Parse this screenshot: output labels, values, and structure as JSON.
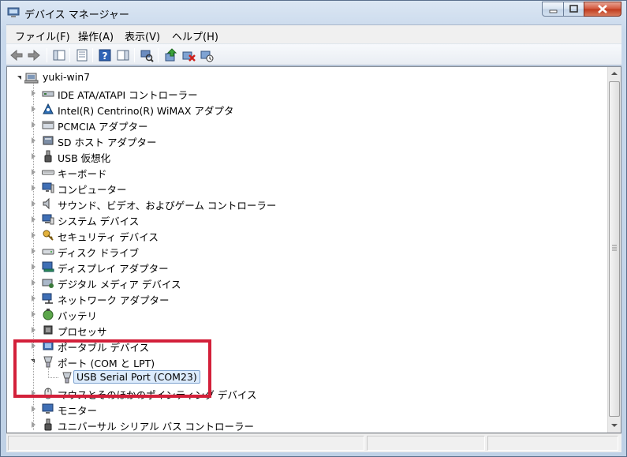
{
  "window": {
    "title": "デバイス マネージャー"
  },
  "menu": [
    {
      "label": "ファイル(F)"
    },
    {
      "label": "操作(A)"
    },
    {
      "label": "表示(V)"
    },
    {
      "label": "ヘルプ(H)"
    }
  ],
  "toolbar": [
    "back-arrow-icon",
    "forward-arrow-icon",
    "show-hide-console-tree-icon",
    "properties-icon",
    "help-icon",
    "action-pane-icon",
    "scan-hardware-icon",
    "update-driver-icon",
    "uninstall-icon",
    "disable-device-icon"
  ],
  "tree": {
    "root": "yuki-win7",
    "items": [
      {
        "label": "IDE ATA/ATAPI コントローラー",
        "icon": "ide-controller-icon"
      },
      {
        "label": "Intel(R) Centrino(R) WiMAX アダプタ",
        "icon": "wimax-icon"
      },
      {
        "label": "PCMCIA アダプター",
        "icon": "pcmcia-icon"
      },
      {
        "label": "SD ホスト アダプター",
        "icon": "sd-host-icon"
      },
      {
        "label": "USB 仮想化",
        "icon": "usb-icon"
      },
      {
        "label": "キーボード",
        "icon": "keyboard-icon"
      },
      {
        "label": "コンピューター",
        "icon": "computer-icon"
      },
      {
        "label": "サウンド、ビデオ、およびゲーム コントローラー",
        "icon": "speaker-icon"
      },
      {
        "label": "システム デバイス",
        "icon": "system-device-icon"
      },
      {
        "label": "セキュリティ デバイス",
        "icon": "security-key-icon"
      },
      {
        "label": "ディスク ドライブ",
        "icon": "disk-drive-icon"
      },
      {
        "label": "ディスプレイ アダプター",
        "icon": "display-adapter-icon"
      },
      {
        "label": "デジタル メディア デバイス",
        "icon": "media-device-icon"
      },
      {
        "label": "ネットワーク アダプター",
        "icon": "network-adapter-icon"
      },
      {
        "label": "バッテリ",
        "icon": "battery-icon"
      },
      {
        "label": "プロセッサ",
        "icon": "processor-icon"
      },
      {
        "label": "ポータブル デバイス",
        "icon": "portable-device-icon"
      },
      {
        "label": "ポート (COM と LPT)",
        "icon": "port-icon",
        "expanded": true,
        "children": [
          {
            "label": "USB Serial Port (COM23)",
            "icon": "serial-port-icon",
            "selected": true
          }
        ]
      },
      {
        "label": "マウスとそのほかのポインティング デバイス",
        "icon": "mouse-icon"
      },
      {
        "label": "モニター",
        "icon": "monitor-icon"
      },
      {
        "label": "ユニバーサル シリアル バス コントローラー",
        "icon": "usb-controller-icon"
      }
    ]
  },
  "highlight_color": "#d3203a",
  "selection_color": "#dcebfc"
}
